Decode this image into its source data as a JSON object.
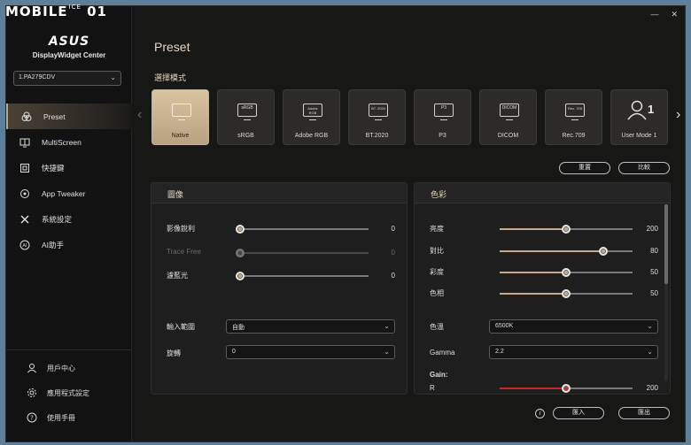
{
  "watermark": {
    "text": "MOBILE",
    "sub": "ICE",
    "mark": "01"
  },
  "window": {
    "minimize": "—",
    "close": "✕"
  },
  "brand": {
    "logo": "ASUS",
    "product": "DisplayWidget Center"
  },
  "monitor": {
    "selected": "1.PA279CDV"
  },
  "nav": [
    {
      "label": "Preset",
      "icon": "palette-icon",
      "active": true
    },
    {
      "label": "MultiScreen",
      "icon": "multiscreen-icon"
    },
    {
      "label": "快捷鍵",
      "icon": "shortcut-icon"
    },
    {
      "label": "App Tweaker",
      "icon": "app-tweaker-icon"
    },
    {
      "label": "系統設定",
      "icon": "tools-icon"
    },
    {
      "label": "AI助手",
      "icon": "ai-icon"
    }
  ],
  "sidebar_bottom": [
    {
      "label": "用戶中心",
      "icon": "user-icon"
    },
    {
      "label": "應用程式設定",
      "icon": "gear-icon"
    },
    {
      "label": "使用手冊",
      "icon": "help-icon"
    }
  ],
  "page": {
    "title": "Preset",
    "mode_section": "選擇模式"
  },
  "modes": [
    {
      "label": "Native",
      "screen": "",
      "active": true
    },
    {
      "label": "sRGB",
      "screen": "sRGB"
    },
    {
      "label": "Adobe RGB",
      "screen": "Adobe RGB"
    },
    {
      "label": "BT.2020",
      "screen": "BT. 2020"
    },
    {
      "label": "P3",
      "screen": "P3"
    },
    {
      "label": "DICOM",
      "screen": "DICOM"
    },
    {
      "label": "Rec.709",
      "screen": "Rec. 709"
    },
    {
      "label": "User Mode 1",
      "screen": "1"
    }
  ],
  "buttons": {
    "reset": "重置",
    "compare": "比較",
    "import": "匯入",
    "export": "匯出",
    "info": "i"
  },
  "image_panel": {
    "title": "圖像",
    "sliders": [
      {
        "label": "影像銳利",
        "value": 0,
        "level": 0,
        "disabled": false
      },
      {
        "label": "Trace Free",
        "value": 0,
        "level": 0,
        "disabled": true
      },
      {
        "label": "濾藍光",
        "value": 0,
        "level": 0,
        "disabled": false
      }
    ],
    "input_range": {
      "label": "輸入範圍",
      "value": "自動"
    },
    "rotation": {
      "label": "旋轉",
      "value": "0"
    }
  },
  "color_panel": {
    "title": "色彩",
    "sliders": [
      {
        "label": "亮度",
        "value": 200,
        "level": 0.5
      },
      {
        "label": "對比",
        "value": 80,
        "level": 0.78
      },
      {
        "label": "彩度",
        "value": 50,
        "level": 0.5
      },
      {
        "label": "色相",
        "value": 50,
        "level": 0.5
      }
    ],
    "color_temp": {
      "label": "色溫",
      "value": "6500K"
    },
    "gamma": {
      "label": "Gamma",
      "value": "2.2"
    },
    "gain": {
      "label": "Gain:",
      "channel": "R",
      "value": 200,
      "level": 0.5
    }
  },
  "colors": {
    "accent": "#d6c19f",
    "gain_red": "#c62828"
  }
}
